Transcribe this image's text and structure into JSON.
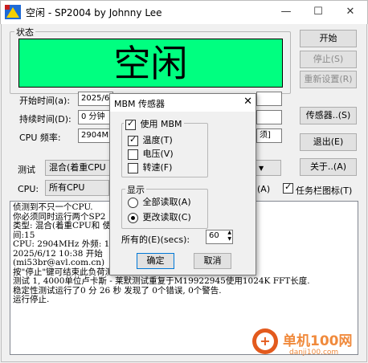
{
  "window": {
    "title": "空闲 - SP2004 by Johnny Lee",
    "minimize_glyph": "—",
    "maximize_glyph": "☐",
    "close_glyph": "✕"
  },
  "status_group": {
    "label": "状态",
    "display": "空闲",
    "display_color": "#00ff80"
  },
  "fields": {
    "start_label": "开始时间(a):",
    "start_value": "2025/6/12 10:38",
    "duration_label": "持续时间(D):",
    "duration_value": "0 分钟",
    "cpu_freq_label": "CPU 频率:",
    "cpu_freq_value": "2904MHz",
    "cpu_freq_suffix": "须]"
  },
  "buttons": {
    "start": "开始",
    "stop": "停止(S)",
    "reset": "重新设置(R)",
    "sensor": "传感器..(S)",
    "exit": "退出(E)",
    "about": "关于..(A)"
  },
  "test_row": {
    "label": "测试",
    "value": "混合(着重CPU"
  },
  "cpu_row": {
    "label": "CPU:",
    "value": "所有CPU",
    "right_fragment": "(A)",
    "taskbar_icon_label": "任务栏图标(T)",
    "taskbar_icon_checked": true
  },
  "log_lines": [
    "侦测到不只一个CPU.",
    "你必须同时运行两个SP2",
    "类型: 混合(着重CPU和                           使用内存:1791.时",
    "间:15",
    "CPU: 2904MHz 外频: 10",
    "2025/6/12 10:38 开始",
    "(mi53br@avl.com.cn)",
    "按\"停止\"键可结束此负荷测试.",
    "测试 1, 4000单位卢卡斯 - 莱默测试重复于M19922945使用1024K FFT长度.",
    "稳定性测试运行了0 分 26 秒 发现了 0个错误, 0个警告.",
    "运行停止."
  ],
  "dialog": {
    "title": "MBM 传感器",
    "close_glyph": "✕",
    "use_mbm_label": "使用 MBM",
    "use_mbm_checked": true,
    "temperature_label": "温度(T)",
    "temperature_checked": true,
    "voltage_label": "电压(V)",
    "voltage_checked": false,
    "fan_label": "转速(F)",
    "fan_checked": false,
    "display_group_label": "显示",
    "read_all_label": "全部读取(A)",
    "read_changed_label": "更改读取(C)",
    "selected_display": "read_changed",
    "interval_label": "所有的(E)(secs):",
    "interval_value": "60",
    "ok_label": "确定",
    "cancel_label": "取消"
  },
  "watermark": {
    "brand": "单机100网",
    "url": "danji100.com"
  }
}
